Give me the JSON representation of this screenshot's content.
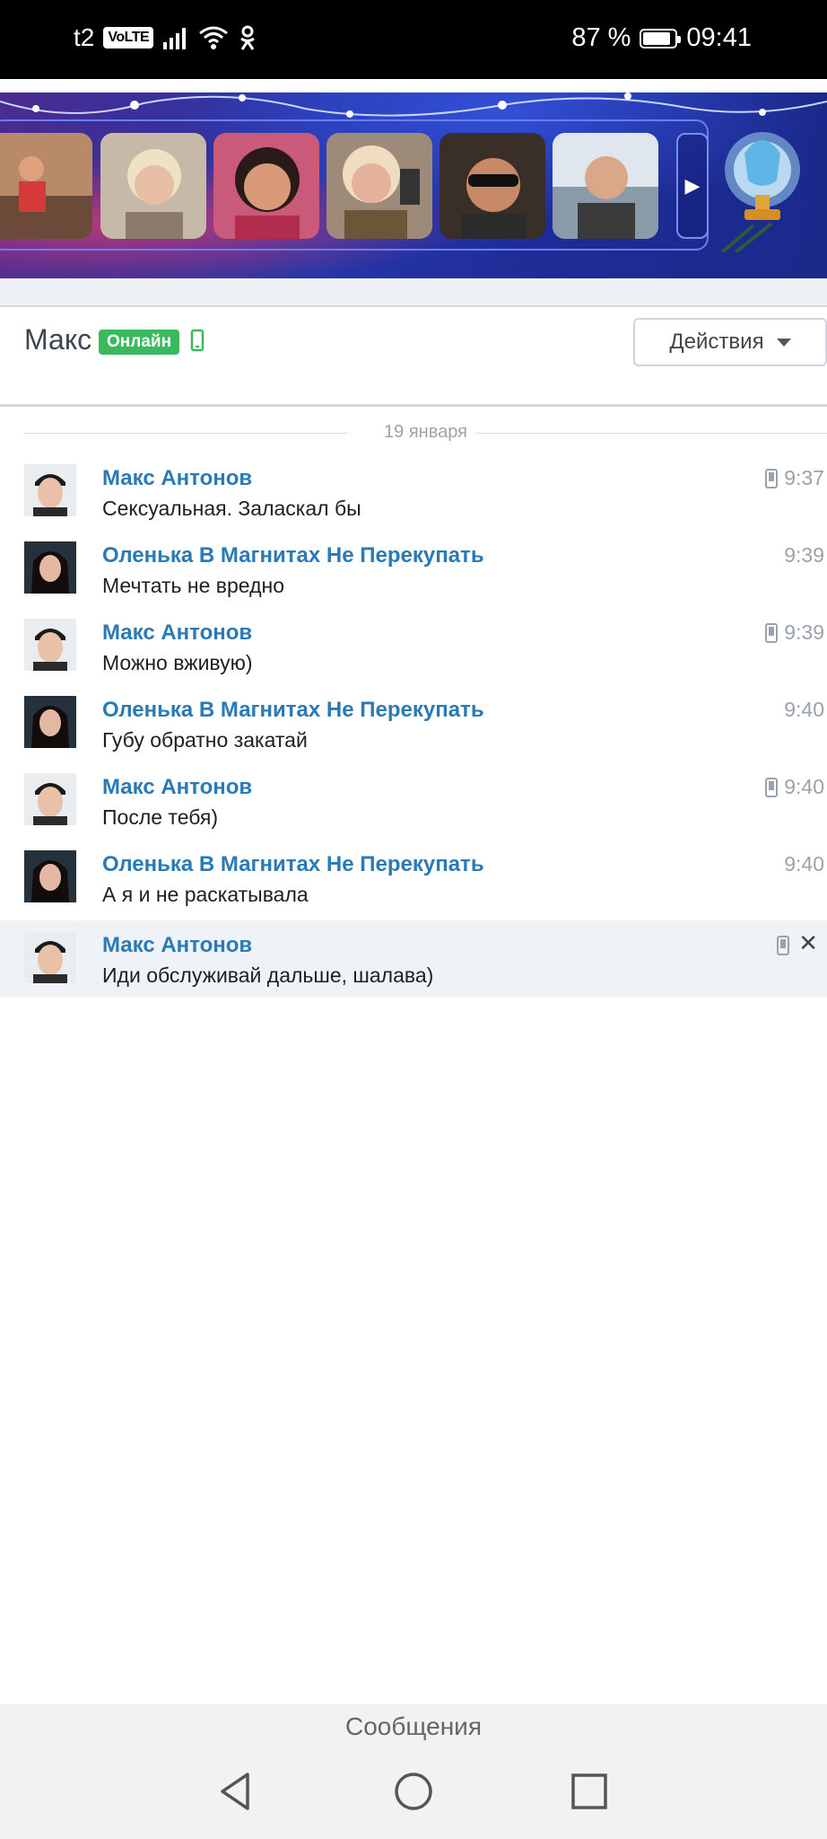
{
  "status_bar": {
    "carrier": "t2",
    "volte": "VoLTE",
    "battery": "87 %",
    "battery_level": 0.87,
    "time": "09:41"
  },
  "banner": {
    "icons": [
      "friend-photo",
      "trophy-icon",
      "arrow-right-icon"
    ]
  },
  "header": {
    "contact_name": "Макс",
    "online_badge": "Онлайн",
    "actions_label": "Действия"
  },
  "date_separator": "19 января",
  "messages": [
    {
      "author": "Макс Антонов",
      "text": "Сексуальная. Заласкал бы",
      "time": "9:37",
      "mobile": true
    },
    {
      "author": "Оленька В Магнитах Не Перекупать",
      "text": "Мечтать не вредно",
      "time": "9:39",
      "mobile": false
    },
    {
      "author": "Макс Антонов",
      "text": "Можно вживую)",
      "time": "9:39",
      "mobile": true
    },
    {
      "author": "Оленька В Магнитах Не Перекупать",
      "text": "Губу обратно закатай",
      "time": "9:40",
      "mobile": false
    },
    {
      "author": "Макс Антонов",
      "text": "После тебя)",
      "time": "9:40",
      "mobile": true
    },
    {
      "author": "Оленька В Магнитах Не Перекупать",
      "text": "А я и не раскатывала",
      "time": "9:40",
      "mobile": false
    },
    {
      "author": "Макс Антонов",
      "text": "Иди обслуживай дальше, шалава)",
      "time": "",
      "mobile": true
    }
  ],
  "bottom": {
    "title": "Сообщения"
  },
  "colors": {
    "link": "#2a7ab5",
    "online": "#3ab95e",
    "highlight_row": "#eff2f6"
  }
}
